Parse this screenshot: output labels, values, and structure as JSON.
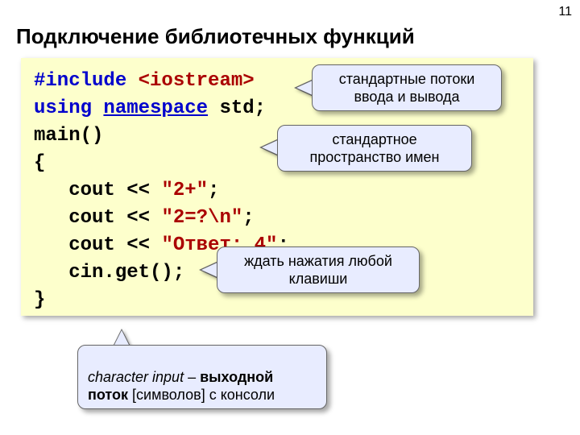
{
  "page_number": "11",
  "title": "Подключение библиотечных функций",
  "code": {
    "l1a": "#include ",
    "l1b": "<iostream>",
    "l2a": "using ",
    "l2b": "namespace",
    "l2c": " std;",
    "l3": "main()",
    "l4": "{",
    "l5a": "   cout << ",
    "l5b": "\"2+\"",
    "l5c": ";",
    "l6a": "   cout << ",
    "l6b": "\"2=?\\n\"",
    "l6c": ";",
    "l7a": "   cout << ",
    "l7b": "\"Ответ: 4\"",
    "l7c": ";",
    "l8": "   cin.get();",
    "l9": "}"
  },
  "callouts": {
    "c1": "стандартные потоки\nввода и вывода",
    "c2": "стандартное\nпространство имен",
    "c3": "ждать нажатия любой\nклавиши",
    "c4_em": "character input",
    "c4_mid": " – ",
    "c4_bold": "выходной\nпоток",
    "c4_tail": " [символов] с консоли"
  }
}
